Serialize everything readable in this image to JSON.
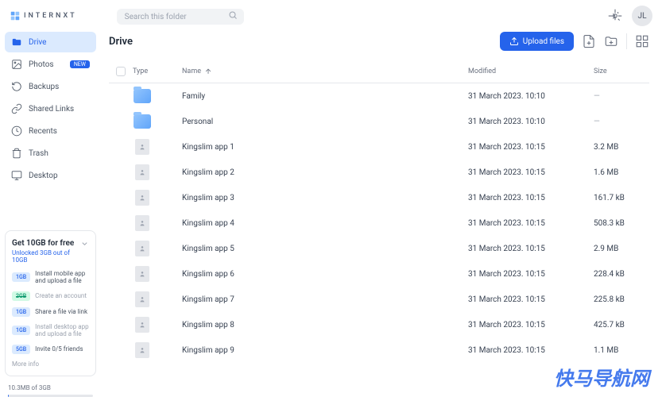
{
  "brand": "INTERNXT",
  "search": {
    "placeholder": "Search this folder"
  },
  "user": {
    "initials": "JL"
  },
  "sidebar": {
    "items": [
      {
        "label": "Drive",
        "icon": "folder"
      },
      {
        "label": "Photos",
        "icon": "photo",
        "badge": "NEW"
      },
      {
        "label": "Backups",
        "icon": "clock-rotate"
      },
      {
        "label": "Shared Links",
        "icon": "link"
      },
      {
        "label": "Recents",
        "icon": "clock"
      },
      {
        "label": "Trash",
        "icon": "trash"
      },
      {
        "label": "Desktop",
        "icon": "desktop"
      }
    ]
  },
  "promo": {
    "title": "Get 10GB for free",
    "subtitle": "Unlocked 3GB out of 10GB",
    "tasks": [
      {
        "badge": "1GB",
        "text": "Install mobile app and upload a file",
        "done": false
      },
      {
        "badge": "2GB",
        "text": "Create an account",
        "done": true
      },
      {
        "badge": "1GB",
        "text": "Share a file via link",
        "done": false
      },
      {
        "badge": "1GB",
        "text": "Install desktop app and upload a file",
        "done": false,
        "muted": true
      },
      {
        "badge": "5GB",
        "text": "Invite 0/5 friends",
        "done": false
      }
    ],
    "more": "More info"
  },
  "usage": {
    "text": "10.3MB of 3GB"
  },
  "page": {
    "title": "Drive"
  },
  "toolbar": {
    "upload": "Upload files"
  },
  "columns": {
    "type": "Type",
    "name": "Name",
    "modified": "Modified",
    "size": "Size"
  },
  "rows": [
    {
      "type": "folder",
      "name": "Family",
      "modified": "31 March 2023. 10:10",
      "size": "—"
    },
    {
      "type": "folder",
      "name": "Personal",
      "modified": "31 March 2023. 10:10",
      "size": "—"
    },
    {
      "type": "file",
      "name": "Kingslim app 1",
      "modified": "31 March 2023. 10:15",
      "size": "3.2 MB"
    },
    {
      "type": "file",
      "name": "Kingslim app 2",
      "modified": "31 March 2023. 10:15",
      "size": "1.6 MB"
    },
    {
      "type": "file",
      "name": "Kingslim app 3",
      "modified": "31 March 2023. 10:15",
      "size": "161.7 kB"
    },
    {
      "type": "file",
      "name": "Kingslim app 4",
      "modified": "31 March 2023. 10:15",
      "size": "508.3 kB"
    },
    {
      "type": "file",
      "name": "Kingslim app 5",
      "modified": "31 March 2023. 10:15",
      "size": "2.9 MB"
    },
    {
      "type": "file",
      "name": "Kingslim app 6",
      "modified": "31 March 2023. 10:15",
      "size": "228.4 kB"
    },
    {
      "type": "file",
      "name": "Kingslim app 7",
      "modified": "31 March 2023. 10:15",
      "size": "225.8 kB"
    },
    {
      "type": "file",
      "name": "Kingslim app 8",
      "modified": "31 March 2023. 10:15",
      "size": "425.7 kB"
    },
    {
      "type": "file",
      "name": "Kingslim app 9",
      "modified": "31 March 2023. 10:15",
      "size": "1.1 MB"
    }
  ],
  "watermark": "快马导航网"
}
